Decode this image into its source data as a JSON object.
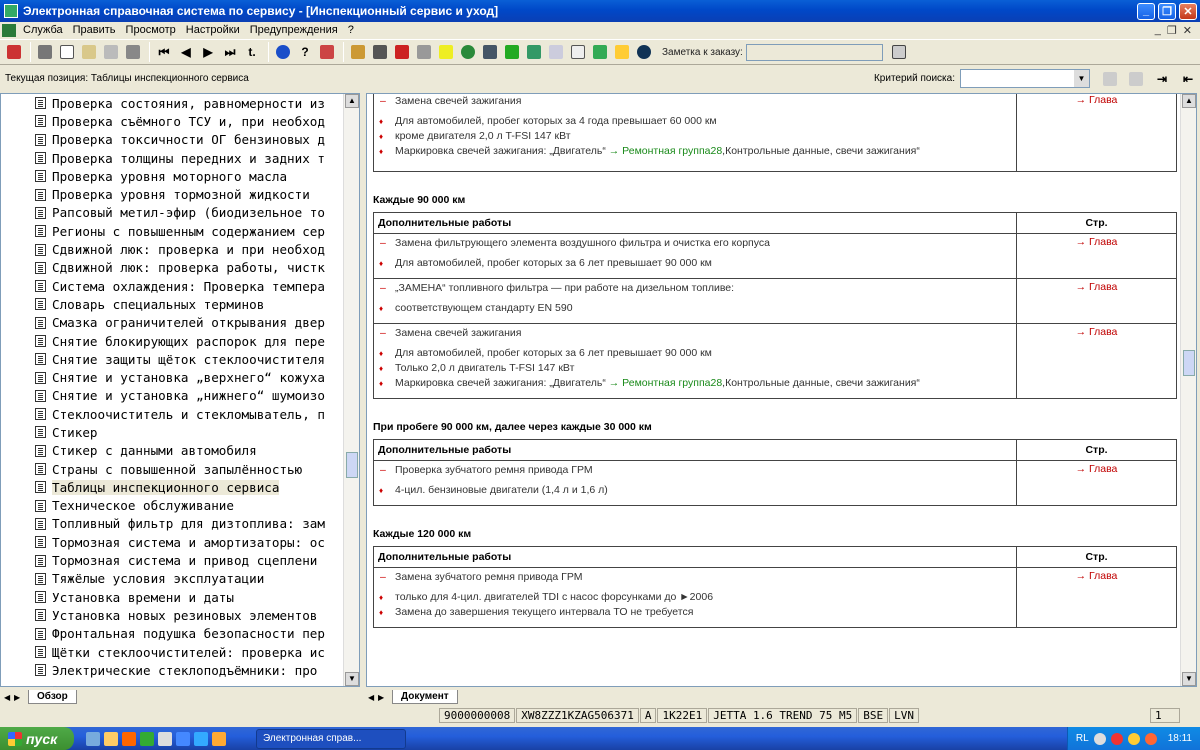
{
  "window": {
    "title": "Электронная справочная система по сервису - [Инспекционный сервис и уход]"
  },
  "menu": {
    "items": [
      "Служба",
      "Править",
      "Просмотр",
      "Настройки",
      "Предупреждения",
      "?"
    ]
  },
  "toolbar": {
    "note_label": "Заметка к заказу:",
    "note_value": ""
  },
  "position": {
    "label": "Текущая позиция: Таблицы инспекционного сервиса",
    "criteria_label": "Критерий поиска:",
    "criteria_value": ""
  },
  "tree": {
    "items": [
      "Проверка состояния, равномерности из",
      "Проверка съёмного ТСУ и, при необход",
      "Проверка токсичности ОГ бензиновых д",
      "Проверка толщины передних и задних т",
      "Проверка уровня моторного масла",
      "Проверка уровня тормозной жидкости",
      "Рапсовый метил-эфир (биодизельное то",
      "Регионы с повышенным содержанием сер",
      "Сдвижной люк: проверка и при необход",
      "Сдвижной люк: проверка работы, чистк",
      "Система охлаждения: Проверка темпера",
      "Словарь специальных терминов",
      "Смазка ограничителей открывания двер",
      "Снятие блокирующих распорок для пере",
      "Снятие защиты щёток стеклоочистителя",
      "Снятие и установка „верхнего“ кожуха",
      "Снятие и установка „нижнего“ шумоизо",
      "Стеклоочиститель и стекломыватель, п",
      "Стикер",
      "Стикер с данными автомобиля",
      "Страны с повышенной запылённостью",
      "Таблицы инспекционного сервиса",
      "Техническое обслуживание",
      "Топливный фильтр для дизтоплива: зам",
      "Тормозная система и амортизаторы: ос",
      "Тормозная система и привод сцеплени",
      "Тяжёлые условия эксплуатации",
      "Установка времени и даты",
      "Установка новых резиновых элементов",
      "Фронтальная подушка безопасности пер",
      "Щётки стеклоочистителей: проверка ис",
      "Электрические стеклоподъёмники: про"
    ],
    "selected_index": 21
  },
  "left_tab": "Обзор",
  "right_tab": "Документ",
  "doc": {
    "top_row": {
      "lines": [
        {
          "type": "dash",
          "text": "Замена свечей зажигания"
        },
        {
          "type": "dot",
          "text": "Для автомобилей, пробег которых за 4 года превышает 60 000 км"
        },
        {
          "type": "dot",
          "text": "кроме двигателя 2,0 л T-FSI 147 кВт"
        },
        {
          "type": "dot",
          "text": "Маркировка свечей зажигания: „Двигатель“ ",
          "link": "→ Ремонтная группа28",
          "tail": ",Контрольные данные, свечи зажигания“"
        }
      ],
      "page": "→ Глава"
    },
    "col_work": "Дополнительные работы",
    "col_page": "Стр.",
    "sections": [
      {
        "title": "Каждые 90 000 км",
        "rows": [
          {
            "page": "→ Глава",
            "lines": [
              {
                "type": "dash",
                "text": "Замена фильтрующего элемента воздушного фильтра и очистка его корпуса"
              },
              {
                "type": "dot",
                "text": "Для автомобилей, пробег которых за 6 лет превышает 90 000 км"
              }
            ]
          },
          {
            "page": "→ Глава",
            "lines": [
              {
                "type": "dash",
                "text": "„ЗАМЕНА“ топливного фильтра — при работе на дизельном топливе:"
              },
              {
                "type": "dot",
                "text": "соответствующем стандарту EN 590"
              }
            ]
          },
          {
            "page": "→ Глава",
            "lines": [
              {
                "type": "dash",
                "text": "Замена свечей зажигания"
              },
              {
                "type": "dot",
                "text": "Для автомобилей, пробег которых за 6 лет превышает 90 000 км"
              },
              {
                "type": "dot",
                "text": "Только 2,0 л двигатель T-FSI 147 кВт"
              },
              {
                "type": "dot",
                "text": "Маркировка свечей зажигания: „Двигатель“ ",
                "link": "→ Ремонтная группа28",
                "tail": ",Контрольные данные, свечи зажигания“"
              }
            ]
          }
        ]
      },
      {
        "title": "При пробеге 90 000 км, далее через каждые 30 000 км",
        "rows": [
          {
            "page": "→ Глава",
            "lines": [
              {
                "type": "dash",
                "text": "Проверка зубчатого ремня привода ГРМ"
              },
              {
                "type": "dot",
                "text": "4-цил. бензиновые двигатели (1,4 л и 1,6 л)"
              }
            ]
          }
        ]
      },
      {
        "title": "Каждые 120 000 км",
        "rows": [
          {
            "page": "→ Глава",
            "lines": [
              {
                "type": "dash",
                "text": "Замена зубчатого ремня привода ГРМ"
              },
              {
                "type": "dot",
                "text": "только для 4-цил. двигателей TDI с насос форсунками до ►2006"
              },
              {
                "type": "dot",
                "text": "Замена до завершения текущего интервала ТО не требуется"
              }
            ]
          }
        ]
      }
    ]
  },
  "status": {
    "order": "9000000008",
    "vin": "XW8ZZZ1KZAG506371",
    "letter": "A",
    "code": "1K22E1",
    "model": "JETTA 1.6 TREND 75 M5",
    "eng": "BSE",
    "trans": "LVN",
    "page": "1"
  },
  "taskbar": {
    "start_label": "пуск",
    "task_label": "Электронная справ...",
    "lang": "RL",
    "clock": "18:11"
  }
}
